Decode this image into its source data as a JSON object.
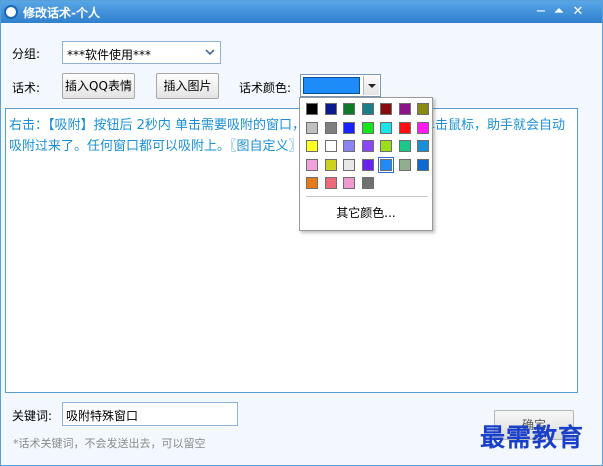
{
  "window": {
    "title": "修改话术-个人"
  },
  "group": {
    "label": "分组:",
    "value": "***软件使用***"
  },
  "script": {
    "label": "话术:"
  },
  "buttons": {
    "insert_qq_emoji": "插入QQ表情",
    "insert_image": "插入图片",
    "ok": "确定"
  },
  "color": {
    "label": "话术颜色:",
    "current": "#1e8cf8",
    "more_label": "其它颜色...",
    "palette": [
      "#000000",
      "#0b1b8f",
      "#0e7a2a",
      "#1a7f86",
      "#8a0b0b",
      "#8a168a",
      "#8a8a12",
      "#bfbfbf",
      "#7f7f7f",
      "#1a22ff",
      "#13e61a",
      "#16e6e6",
      "#ff0f0f",
      "#ff1af2",
      "#ffff22",
      "#ffffff",
      "#8a84f2",
      "#8a48f6",
      "#9adf1a",
      "#1dc78a",
      "#1a8fd7",
      "#f2a2df",
      "#cfd21a",
      "#e8e8e8",
      "#6a24f2",
      "#1e8cf8",
      "#8faf8f",
      "#0e6ad0",
      "#e87a1a",
      "#ee6a7a",
      "#ee9ad0",
      "#707070"
    ]
  },
  "editor": {
    "content": "右击：【吸附】按钮后 2秒内 单击需要吸附的窗口，在需要吸附的窗口上单击鼠标，助手就会自动吸附过来了。任何窗口都可以吸附上。〖图自定义〗"
  },
  "keyword": {
    "label": "关键词:",
    "value": "吸附特殊窗口",
    "hint": "*话术关键词，不会发送出去，可以留空"
  },
  "watermark": "最需教育"
}
